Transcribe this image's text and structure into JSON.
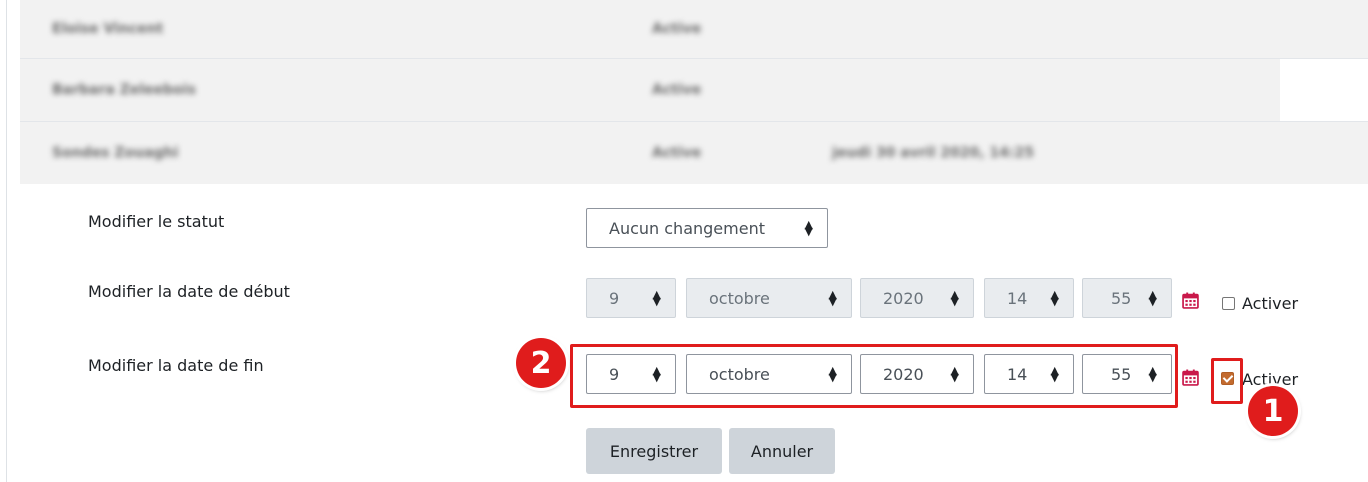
{
  "users": [
    {
      "name": "Eloise Vincent",
      "status": "Active",
      "date": ""
    },
    {
      "name": "Barbara Zeleebois",
      "status": "Active",
      "date": ""
    },
    {
      "name": "Sondes Zouaghi",
      "status": "Active",
      "date": "jeudi 30 avril 2020, 14:25"
    }
  ],
  "form": {
    "status_label": "Modifier le statut",
    "status_value": "Aucun changement",
    "start_label": "Modifier la date de début",
    "start": {
      "day": "9",
      "month": "octobre",
      "year": "2020",
      "hour": "14",
      "minute": "55",
      "enable_label": "Activer",
      "enabled": false
    },
    "end_label": "Modifier la date de fin",
    "end": {
      "day": "9",
      "month": "octobre",
      "year": "2020",
      "hour": "14",
      "minute": "55",
      "enable_label": "Activer",
      "enabled": true
    },
    "save_label": "Enregistrer",
    "cancel_label": "Annuler"
  },
  "annotations": {
    "badge1": "1",
    "badge2": "2",
    "color": "#e01c1c"
  },
  "icons": {
    "calendar": "calendar-icon",
    "select_arrows": "sort-arrows-icon"
  }
}
